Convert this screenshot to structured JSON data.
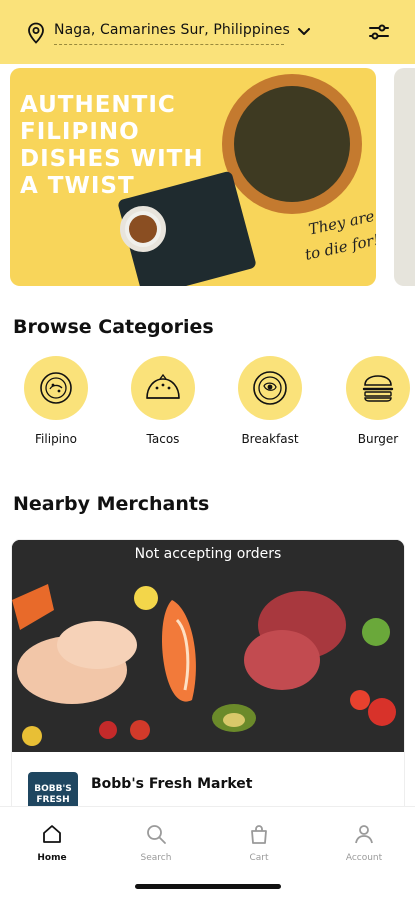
{
  "header": {
    "location": "Naga, Camarines Sur, Philippines",
    "icons": {
      "location": "map-pin-icon",
      "dropdown": "chevron-down-icon",
      "filter": "filter-sliders-icon"
    }
  },
  "banner": {
    "title": "AUTHENTIC FILIPINO DISHES WITH A TWIST",
    "tagline_line1": "They are",
    "tagline_line2": "to die for!",
    "background": "#f8d55a"
  },
  "categories": {
    "title": "Browse Categories",
    "items": [
      {
        "label": "Filipino",
        "icon": "filipino-dish-icon"
      },
      {
        "label": "Tacos",
        "icon": "taco-icon"
      },
      {
        "label": "Breakfast",
        "icon": "breakfast-plate-icon"
      },
      {
        "label": "Burger",
        "icon": "burger-icon"
      }
    ]
  },
  "merchants": {
    "title": "Nearby Merchants",
    "items": [
      {
        "status": "Not accepting orders",
        "name": "Bobb's Fresh Market",
        "logo_text_line1": "BOBB'S",
        "logo_text_line2": "FRESH"
      }
    ]
  },
  "nav": {
    "items": [
      {
        "label": "Home",
        "icon": "home-icon",
        "active": true
      },
      {
        "label": "Search",
        "icon": "search-icon",
        "active": false
      },
      {
        "label": "Cart",
        "icon": "cart-bag-icon",
        "active": false
      },
      {
        "label": "Account",
        "icon": "account-icon",
        "active": false
      }
    ]
  },
  "colors": {
    "accent": "#fae27a",
    "text": "#111111",
    "muted": "#9a9a9a"
  }
}
